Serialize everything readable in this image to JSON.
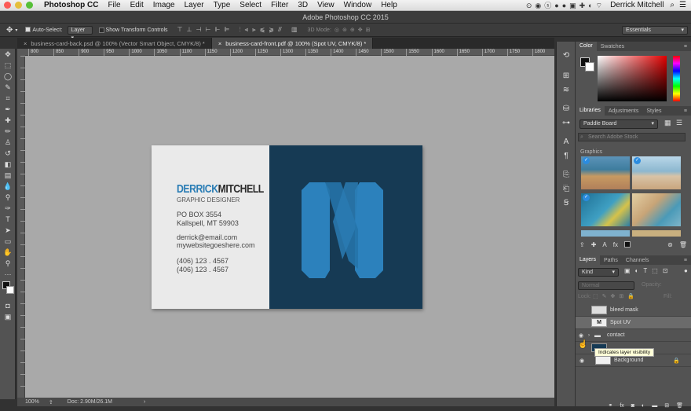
{
  "menubar": {
    "app_name": "Photoshop CC",
    "items": [
      "File",
      "Edit",
      "Image",
      "Layer",
      "Type",
      "Select",
      "Filter",
      "3D",
      "View",
      "Window",
      "Help"
    ],
    "user": "Derrick Mitchell"
  },
  "window_title": "Adobe Photoshop CC 2015",
  "options": {
    "auto_select_label": "Auto-Select:",
    "auto_select_value": "Layer",
    "transform_label": "Show Transform Controls",
    "mode_3d": "3D Mode:",
    "workspace": "Essentials"
  },
  "doc_tabs": [
    {
      "label": "business-card-back.psd @ 100% (Vector Smart Object, CMYK/8) *"
    },
    {
      "label": "business-card-front.pdf @ 100% (Spot UV, CMYK/8) *"
    }
  ],
  "ruler_labels": [
    "800",
    "850",
    "900",
    "950",
    "1000",
    "1050",
    "1100",
    "1150",
    "1200",
    "1250",
    "1300",
    "1350",
    "1400",
    "1450",
    "1500",
    "1550",
    "1600",
    "1650",
    "1700",
    "1750",
    "1800"
  ],
  "card": {
    "name_first": "DERRICK",
    "name_last": "MITCHELL",
    "job_title": "GRAPHIC DESIGNER",
    "address_1": "PO BOX 3554",
    "address_2": "Kallspell, MT 59903",
    "email": "derrick@email.com",
    "website": "mywebsitegoeshere.com",
    "phone_1": "(406) 123 . 4567",
    "phone_2": "(406) 123 . 4567",
    "accent": "#2a7db5",
    "dark": "#163a54"
  },
  "status": {
    "zoom": "100%",
    "doc": "Doc: 2.90M/26.1M"
  },
  "color_panel": {
    "tabs": [
      "Color",
      "Swatches"
    ]
  },
  "libraries_panel": {
    "tabs": [
      "Libraries",
      "Adjustments",
      "Styles"
    ],
    "library": "Paddle Board",
    "search_placeholder": "Search Adobe Stock",
    "section": "Graphics"
  },
  "layers_panel": {
    "tabs": [
      "Layers",
      "Paths",
      "Channels"
    ],
    "filter": "Kind",
    "blend": "Normal",
    "opacity_label": "Opacity:",
    "lock_label": "Lock:",
    "fill_label": "Fill:",
    "layers": [
      {
        "name": "bleed mask"
      },
      {
        "name": "Spot UV"
      },
      {
        "name": "contact"
      },
      {
        "name": ""
      },
      {
        "name": "Background"
      }
    ],
    "tooltip": "Indicates layer visibility"
  }
}
